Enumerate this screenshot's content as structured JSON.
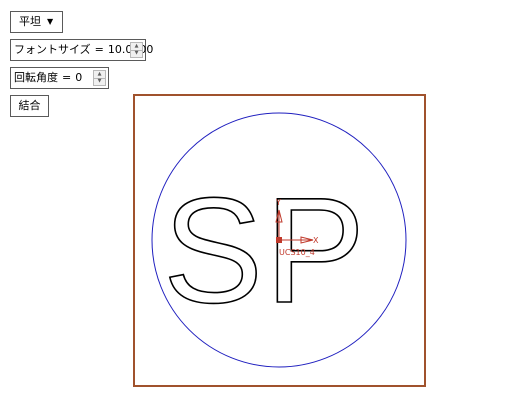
{
  "toolbar": {
    "mode_dropdown": {
      "value": "平坦",
      "caret": "▼"
    },
    "font_size": {
      "label": "フォントサイズ",
      "equals": "=",
      "value": "10.0000"
    },
    "rotation_angle": {
      "label": "回転角度",
      "equals": "=",
      "value": "0"
    },
    "merge_button": {
      "label": "結合"
    },
    "spinner_up": "▲",
    "spinner_down": "▼"
  },
  "canvas": {
    "text": "SP",
    "ucs": {
      "x_label": "X",
      "y_label": "Y",
      "name": "UCS10_4"
    },
    "colors": {
      "frame": "#a0522d",
      "circle": "#1f1fbf",
      "glyph_outline": "#000000",
      "ucs": "#c0392b"
    }
  }
}
